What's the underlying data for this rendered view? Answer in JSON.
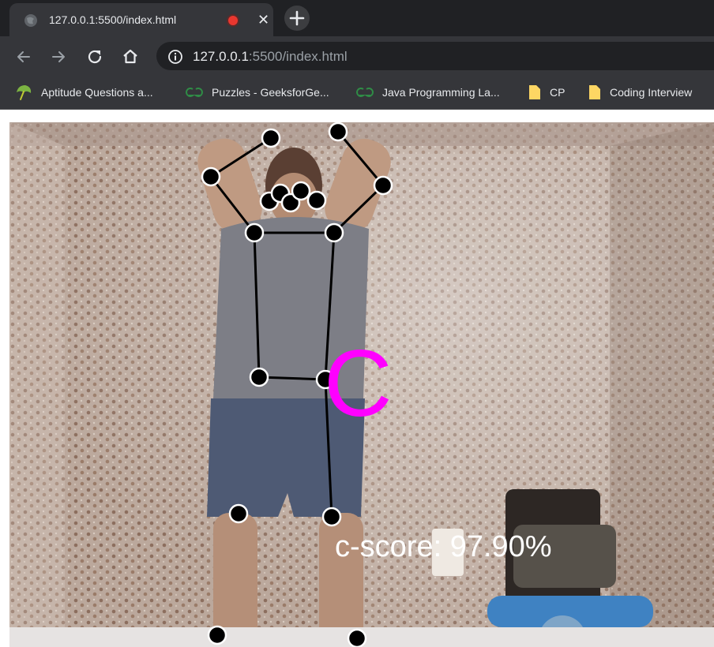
{
  "browser": {
    "tab": {
      "title": "127.0.0.1:5500/index.html"
    },
    "address": {
      "host": "127.0.0.1",
      "rest": ":5500/index.html"
    },
    "bookmarks": [
      {
        "label": "Aptitude Questions a...",
        "icon": "umbrella-icon"
      },
      {
        "label": "Puzzles - GeeksforGe...",
        "icon": "geeksforgeeks-icon"
      },
      {
        "label": "Java Programming La...",
        "icon": "geeksforgeeks-icon"
      },
      {
        "label": "CP",
        "icon": "folder-icon"
      },
      {
        "label": "Coding Interview",
        "icon": "folder-icon"
      }
    ]
  },
  "overlay": {
    "letter": "C",
    "score": "c-score: 97.90%",
    "letter_color": "#ff00ff",
    "keypoint_color": "#000000",
    "skeleton_color": "#000000"
  }
}
